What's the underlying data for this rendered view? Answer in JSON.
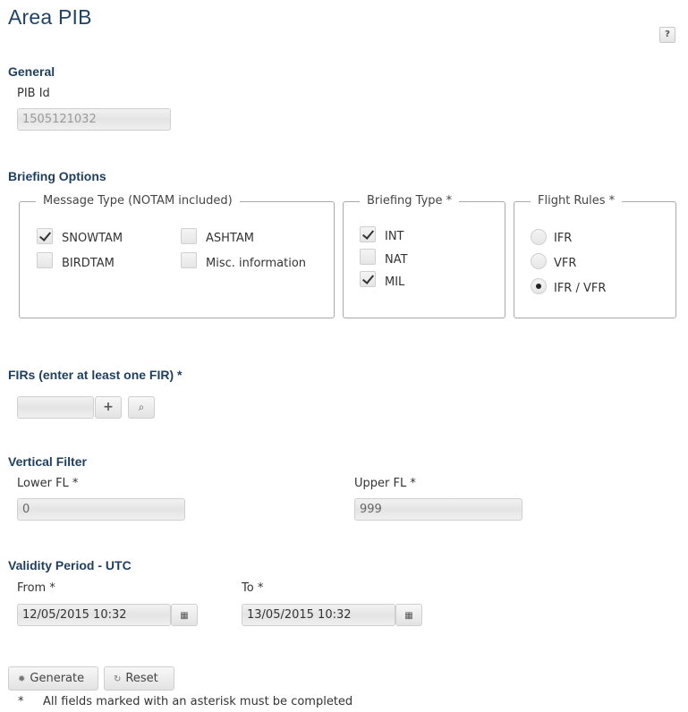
{
  "page": {
    "title": "Area PIB",
    "help_label": "?"
  },
  "general": {
    "title": "General",
    "pib_id_label": "PIB Id",
    "pib_id_value": "1505121032"
  },
  "briefing_options": {
    "title": "Briefing Options",
    "message_type": {
      "legend": "Message Type (NOTAM included)",
      "items": [
        {
          "label": "SNOWTAM",
          "checked": true
        },
        {
          "label": "ASHTAM",
          "checked": false
        },
        {
          "label": "BIRDTAM",
          "checked": false
        },
        {
          "label": "Misc. information",
          "checked": false
        }
      ]
    },
    "briefing_type": {
      "legend": "Briefing Type *",
      "items": [
        {
          "label": "INT",
          "checked": true
        },
        {
          "label": "NAT",
          "checked": false
        },
        {
          "label": "MIL",
          "checked": true
        }
      ]
    },
    "flight_rules": {
      "legend": "Flight Rules *",
      "items": [
        {
          "label": "IFR",
          "selected": false
        },
        {
          "label": "VFR",
          "selected": false
        },
        {
          "label": "IFR / VFR",
          "selected": true
        }
      ]
    }
  },
  "firs": {
    "title": "FIRs (enter at least one FIR) *",
    "value": "",
    "add_icon": "plus-icon",
    "search_icon": "search-icon",
    "add_glyph": "+",
    "search_glyph": "⌕"
  },
  "vertical_filter": {
    "title": "Vertical Filter",
    "lower_label": "Lower FL *",
    "lower_value": "0",
    "upper_label": "Upper FL *",
    "upper_value": "999"
  },
  "validity": {
    "title": "Validity Period - UTC",
    "from_label": "From *",
    "from_value": "12/05/2015 10:32",
    "to_label": "To *",
    "to_value": "13/05/2015 10:32",
    "calendar_icon": "calendar-icon",
    "calendar_glyph": "▦"
  },
  "actions": {
    "generate_label": "Generate",
    "generate_icon": "gear-icon",
    "generate_glyph": "✹",
    "reset_label": "Reset",
    "reset_icon": "refresh-icon",
    "reset_glyph": "↻"
  },
  "footer": {
    "asterisk": "*",
    "note": "All fields marked with an asterisk must be completed"
  }
}
